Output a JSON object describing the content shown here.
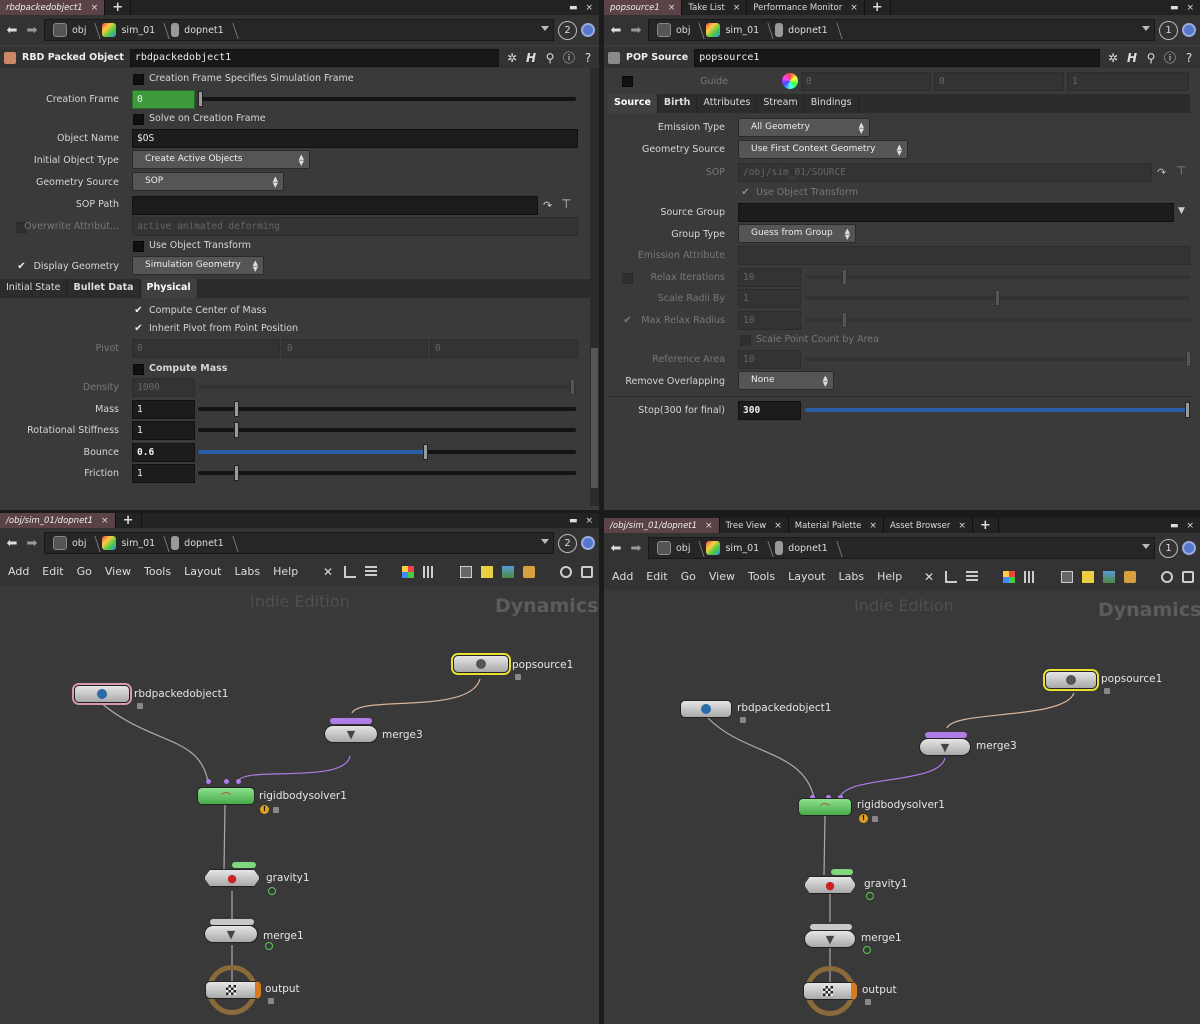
{
  "tl": {
    "tabs": [
      {
        "label": "rbdpackedobject1"
      }
    ],
    "path": {
      "items": [
        "obj",
        "sim_01",
        "dopnet1"
      ],
      "badge": "2"
    },
    "header": {
      "type": "RBD Packed Object",
      "name": "rbdpackedobject1"
    },
    "params": {
      "creation_frame_specifies": "Creation Frame Specifies Simulation Frame",
      "creation_frame_label": "Creation Frame",
      "creation_frame_value": "0",
      "solve_on_creation": "Solve on Creation Frame",
      "object_name_label": "Object Name",
      "object_name_value": "$OS",
      "initial_object_type_label": "Initial Object Type",
      "initial_object_type_value": "Create Active Objects",
      "geometry_source_label": "Geometry Source",
      "geometry_source_value": "SOP",
      "sop_path_label": "SOP Path",
      "sop_path_value": "",
      "overwrite_label": "Overwrite Attribut...",
      "overwrite_value": "active animated deforming",
      "use_object_transform": "Use Object Transform",
      "display_geometry_label": "Display Geometry",
      "display_geometry_value": "Simulation Geometry"
    },
    "subtabs": [
      "Initial State",
      "Bullet Data",
      "Physical"
    ],
    "physical": {
      "compute_center": "Compute Center of Mass",
      "inherit_pivot": "Inherit Pivot from Point Position",
      "pivot_label": "Pivot",
      "pivot_values": [
        "0",
        "0",
        "0"
      ],
      "compute_mass": "Compute Mass",
      "density_label": "Density",
      "density_value": "1000",
      "mass_label": "Mass",
      "mass_value": "1",
      "rot_stiff_label": "Rotational Stiffness",
      "rot_stiff_value": "1",
      "bounce_label": "Bounce",
      "bounce_value": "0.6",
      "friction_label": "Friction",
      "friction_value": "1"
    }
  },
  "tr": {
    "tabs": [
      {
        "label": "popsource1"
      },
      {
        "label": "Take List"
      },
      {
        "label": "Performance Monitor"
      }
    ],
    "path": {
      "items": [
        "obj",
        "sim_01",
        "dopnet1"
      ],
      "badge": "1"
    },
    "header": {
      "type": "POP Source",
      "name": "popsource1"
    },
    "guide": {
      "label": "Guide",
      "values": [
        "0",
        "0",
        "1"
      ]
    },
    "subtabs": [
      "Source",
      "Birth",
      "Attributes",
      "Stream",
      "Bindings"
    ],
    "params": {
      "emission_type_label": "Emission Type",
      "emission_type_value": "All Geometry",
      "geometry_source_label": "Geometry Source",
      "geometry_source_value": "Use First Context Geometry",
      "sop_label": "SOP",
      "sop_value": "/obj/sim_01/SOURCE",
      "use_object_transform": "Use Object Transform",
      "source_group_label": "Source Group",
      "source_group_value": "",
      "group_type_label": "Group Type",
      "group_type_value": "Guess from Group",
      "emission_attr_label": "Emission Attribute",
      "relax_iter_label": "Relax Iterations",
      "relax_iter_value": "10",
      "scale_radii_label": "Scale Radii By",
      "scale_radii_value": "1",
      "max_relax_label": "Max Relax Radius",
      "max_relax_value": "10",
      "scale_point_count": "Scale Point Count by Area",
      "ref_area_label": "Reference Area",
      "ref_area_value": "10",
      "remove_overlap_label": "Remove Overlapping",
      "remove_overlap_value": "None",
      "stop_label": "Stop(300 for final)",
      "stop_value": "300"
    }
  },
  "bl": {
    "tabs": [
      {
        "label": "/obj/sim_01/dopnet1"
      }
    ],
    "path": {
      "items": [
        "obj",
        "sim_01",
        "dopnet1"
      ],
      "badge": "2"
    },
    "menu": [
      "Add",
      "Edit",
      "Go",
      "View",
      "Tools",
      "Layout",
      "Labs",
      "Help"
    ],
    "watermark": {
      "edition": "Indie Edition",
      "context": "Dynamics"
    },
    "nodes": {
      "popsource": "popsource1",
      "rbd": "rbdpackedobject1",
      "merge3": "merge3",
      "solver": "rigidbodysolver1",
      "gravity": "gravity1",
      "merge1": "merge1",
      "output": "output"
    }
  },
  "br": {
    "tabs": [
      {
        "label": "/obj/sim_01/dopnet1"
      },
      {
        "label": "Tree View"
      },
      {
        "label": "Material Palette"
      },
      {
        "label": "Asset Browser"
      }
    ],
    "path": {
      "items": [
        "obj",
        "sim_01",
        "dopnet1"
      ],
      "badge": "1"
    },
    "menu": [
      "Add",
      "Edit",
      "Go",
      "View",
      "Tools",
      "Layout",
      "Labs",
      "Help"
    ],
    "watermark": {
      "edition": "Indie Edition",
      "context": "Dynamics"
    },
    "nodes": {
      "popsource": "popsource1",
      "rbd": "rbdpackedobject1",
      "merge3": "merge3",
      "solver": "rigidbodysolver1",
      "gravity": "gravity1",
      "merge1": "merge1",
      "output": "output"
    }
  },
  "colors": {
    "accent_blue": "#2a5ea8",
    "node_green": "#48aa48",
    "selected_yellow": "#e8e030",
    "creation_field_green": "#3d9a3d"
  }
}
